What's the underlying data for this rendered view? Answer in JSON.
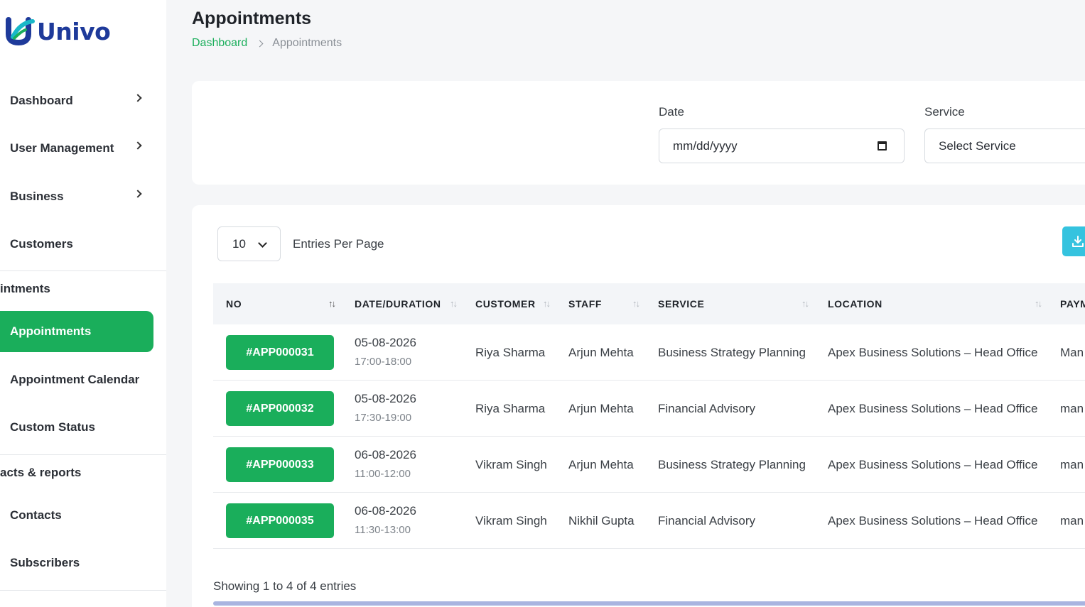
{
  "brand": {
    "name": "Univo"
  },
  "sidebar": {
    "items": [
      {
        "label": "Dashboard",
        "has_chevron": true
      },
      {
        "label": "User Management",
        "has_chevron": true
      },
      {
        "label": "Business",
        "has_chevron": true
      },
      {
        "label": "Customers",
        "has_chevron": false
      }
    ],
    "section_appointments": "intments",
    "active_item": "Appointments",
    "sub_items": [
      {
        "label": "Appointment Calendar"
      },
      {
        "label": "Custom Status"
      }
    ],
    "section_contacts": "acts & reports",
    "contact_items": [
      {
        "label": "Contacts"
      },
      {
        "label": "Subscribers"
      }
    ]
  },
  "header": {
    "title": "Appointments",
    "breadcrumb": {
      "home": "Dashboard",
      "current": "Appointments"
    }
  },
  "filters": {
    "date_label": "Date",
    "date_placeholder": "mm/dd/yyyy",
    "service_label": "Service",
    "service_value": "Select Service"
  },
  "table": {
    "entries_value": "10",
    "entries_label": "Entries Per Page",
    "columns": [
      "NO",
      "DATE/DURATION",
      "CUSTOMER",
      "STAFF",
      "SERVICE",
      "LOCATION",
      "PAYM"
    ],
    "rows": [
      {
        "id": "#APP000031",
        "date": "05-08-2026",
        "duration": "17:00-18:00",
        "customer": "Riya Sharma",
        "staff": "Arjun Mehta",
        "service": "Business Strategy Planning",
        "location": "Apex Business Solutions – Head Office",
        "payment": "Man"
      },
      {
        "id": "#APP000032",
        "date": "05-08-2026",
        "duration": "17:30-19:00",
        "customer": "Riya Sharma",
        "staff": "Arjun Mehta",
        "service": "Financial Advisory",
        "location": "Apex Business Solutions – Head Office",
        "payment": "man"
      },
      {
        "id": "#APP000033",
        "date": "06-08-2026",
        "duration": "11:00-12:00",
        "customer": "Vikram Singh",
        "staff": "Arjun Mehta",
        "service": "Business Strategy Planning",
        "location": "Apex Business Solutions – Head Office",
        "payment": "man"
      },
      {
        "id": "#APP000035",
        "date": "06-08-2026",
        "duration": "11:30-13:00",
        "customer": "Vikram Singh",
        "staff": "Nikhil Gupta",
        "service": "Financial Advisory",
        "location": "Apex Business Solutions – Head Office",
        "payment": "man"
      }
    ],
    "showing": "Showing 1 to 4 of 4 entries"
  },
  "colors": {
    "accent": "#1aae5b",
    "brand_blue": "#1e3a9a",
    "download": "#35c3df"
  },
  "icons": [
    "chevron-right-icon",
    "calendar-icon",
    "chevron-down-icon",
    "download-icon",
    "sort-icon"
  ]
}
